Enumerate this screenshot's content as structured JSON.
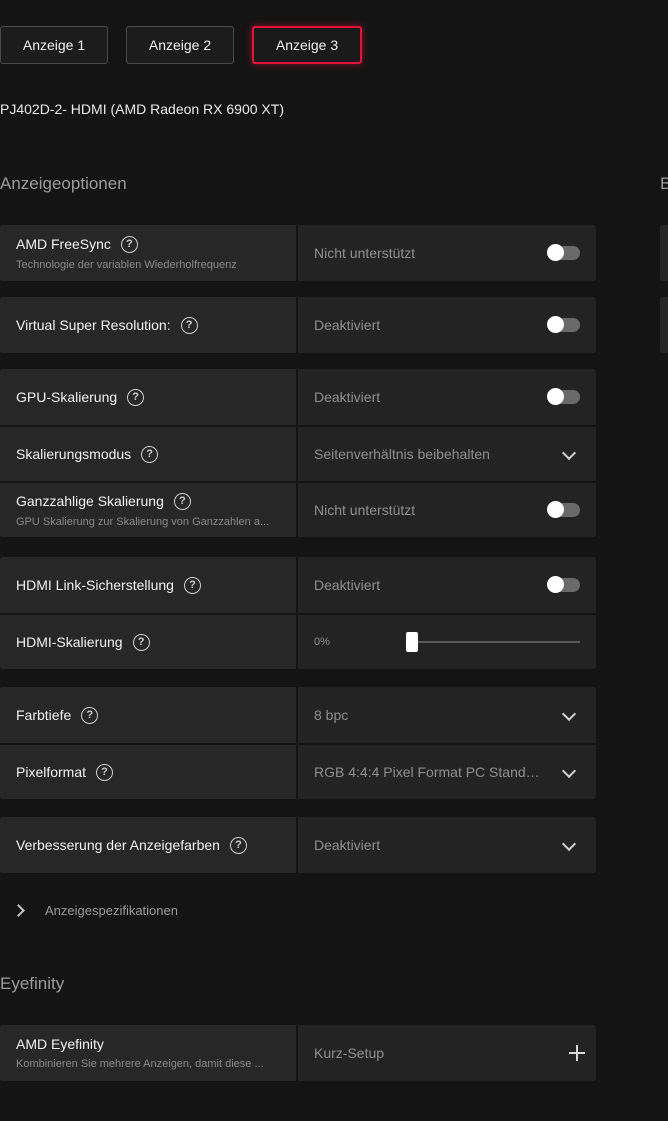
{
  "tabs": [
    {
      "label": "Anzeige 1",
      "active": false
    },
    {
      "label": "Anzeige 2",
      "active": false
    },
    {
      "label": "Anzeige 3",
      "active": true
    }
  ],
  "display_name": "PJ402D-2- HDMI (AMD Radeon RX 6900 XT)",
  "sections": {
    "display_options_title": "Anzeigeoptionen",
    "right_panel_title_partial": "B",
    "eyefinity_title": "Eyefinity"
  },
  "settings": {
    "freesync": {
      "label": "AMD FreeSync",
      "sublabel": "Technologie der variablen Wiederholfrequenz",
      "value": "Nicht unterstützt",
      "enabled": false
    },
    "vsr": {
      "label": "Virtual Super Resolution:",
      "value": "Deaktiviert",
      "enabled": false
    },
    "gpu_scaling": {
      "label": "GPU-Skalierung",
      "value": "Deaktiviert",
      "enabled": false
    },
    "scaling_mode": {
      "label": "Skalierungsmodus",
      "value": "Seitenverhältnis beibehalten"
    },
    "integer_scaling": {
      "label": "Ganzzahlige Skalierung",
      "sublabel": "GPU Skalierung zur Skalierung von Ganzzahlen a...",
      "value": "Nicht unterstützt",
      "enabled": false
    },
    "hdmi_link": {
      "label": "HDMI Link-Sicherstellung",
      "value": "Deaktiviert",
      "enabled": false
    },
    "hdmi_scaling": {
      "label": "HDMI-Skalierung",
      "value": "0%",
      "level": 0
    },
    "color_depth": {
      "label": "Farbtiefe",
      "value": "8 bpc"
    },
    "pixel_format": {
      "label": "Pixelformat",
      "value": "RGB 4:4:4 Pixel Format PC Standar..."
    },
    "color_enhancement": {
      "label": "Verbesserung der Anzeigefarben",
      "value": "Deaktiviert"
    }
  },
  "specs_expander": {
    "label": "Anzeigespezifikationen"
  },
  "eyefinity": {
    "label": "AMD Eyefinity",
    "sublabel": "Kombinieren Sie mehrere Anzeigen, damit diese ...",
    "action": "Kurz-Setup"
  },
  "colors": {
    "accent": "#e2143b",
    "background": "#141414",
    "card": "#272727"
  }
}
